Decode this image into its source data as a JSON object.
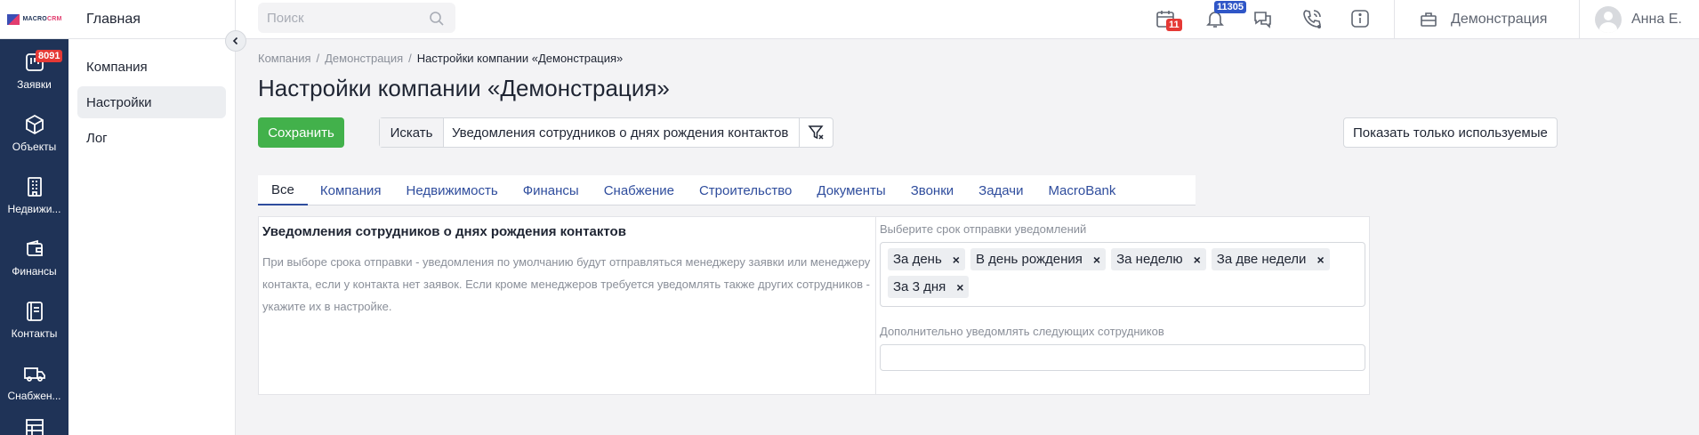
{
  "logo": {
    "text_macro": "MACRO",
    "text_crm": "CRM"
  },
  "leftnav": [
    {
      "label": "Заявки",
      "icon": "requests-icon",
      "badge": "8091"
    },
    {
      "label": "Объекты",
      "icon": "cube-icon"
    },
    {
      "label": "Недвижи...",
      "icon": "building-icon"
    },
    {
      "label": "Финансы",
      "icon": "wallet-icon"
    },
    {
      "label": "Контакты",
      "icon": "contacts-icon"
    },
    {
      "label": "Снабжен...",
      "icon": "truck-icon"
    }
  ],
  "subside": {
    "home": "Главная",
    "items": [
      {
        "label": "Компания",
        "active": false
      },
      {
        "label": "Настройки",
        "active": true
      },
      {
        "label": "Лог",
        "active": false
      }
    ]
  },
  "topbar": {
    "search_placeholder": "Поиск",
    "calendar_badge": "11",
    "notifications_badge": "11305",
    "company": "Демонстрация",
    "user": "Анна Е."
  },
  "breadcrumb": [
    "Компания",
    "Демонстрация",
    "Настройки компании «Демонстрация»"
  ],
  "page_title": "Настройки компании «Демонстрация»",
  "toolbar": {
    "save_label": "Сохранить",
    "search_button": "Искать",
    "search_value": "Уведомления сотрудников о днях рождения контактов",
    "show_used_label": "Показать только используемые"
  },
  "tabs": [
    "Все",
    "Компания",
    "Недвижимость",
    "Финансы",
    "Снабжение",
    "Строительство",
    "Документы",
    "Звонки",
    "Задачи",
    "MacroBank"
  ],
  "setting": {
    "title": "Уведомления сотрудников о днях рождения контактов",
    "description": "При выборе срока отправки - уведомления по умолчанию будут отправляться менеджеру заявки или менеджеру контакта, если у контакта нет заявок. Если кроме менеджеров требуется уведомлять также других сотрудников - укажите их в настройке.",
    "period_label": "Выберите срок отправки уведомлений",
    "period_tags": [
      "За день",
      "В день рождения",
      "За неделю",
      "За две недели",
      "За 3 дня"
    ],
    "extra_label": "Дополнительно уведомлять следующих сотрудников"
  },
  "colors": {
    "nav_bg": "#1f3357",
    "save_green": "#42b14b",
    "link_blue": "#2f4d9d",
    "badge_red": "#e53935",
    "badge_blue": "#2f56c7"
  }
}
